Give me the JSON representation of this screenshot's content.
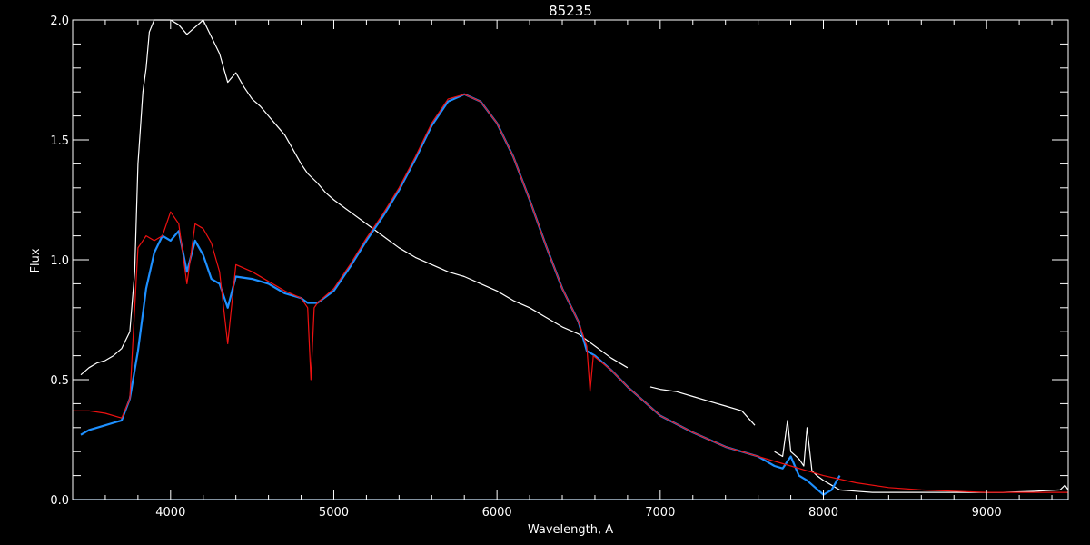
{
  "chart_data": {
    "type": "line",
    "title": "85235",
    "xlabel": "Wavelength, A",
    "ylabel": "Flux",
    "xlim": [
      3400,
      9500
    ],
    "ylim": [
      0.0,
      2.0
    ],
    "x_ticks": [
      4000,
      5000,
      6000,
      7000,
      8000,
      9000
    ],
    "x_tick_labels": [
      "4000",
      "5000",
      "6000",
      "7000",
      "8000",
      "9000"
    ],
    "y_ticks": [
      0.0,
      0.5,
      1.0,
      1.5,
      2.0
    ],
    "y_tick_labels": [
      "0.0",
      "0.5",
      "1.0",
      "1.5",
      "2.0"
    ],
    "grid": false,
    "series": [
      {
        "color": "#ffffff",
        "points": [
          [
            3450,
            0.52
          ],
          [
            3500,
            0.55
          ],
          [
            3550,
            0.57
          ],
          [
            3600,
            0.58
          ],
          [
            3650,
            0.6
          ],
          [
            3700,
            0.63
          ],
          [
            3750,
            0.7
          ],
          [
            3780,
            0.95
          ],
          [
            3800,
            1.4
          ],
          [
            3830,
            1.7
          ],
          [
            3850,
            1.8
          ],
          [
            3870,
            1.95
          ],
          [
            3900,
            2.0
          ],
          [
            3950,
            2.0
          ],
          [
            4000,
            2.0
          ],
          [
            4050,
            1.98
          ],
          [
            4100,
            1.94
          ],
          [
            4150,
            1.97
          ],
          [
            4200,
            2.0
          ],
          [
            4250,
            1.93
          ],
          [
            4300,
            1.86
          ],
          [
            4350,
            1.74
          ],
          [
            4400,
            1.78
          ],
          [
            4450,
            1.72
          ],
          [
            4500,
            1.67
          ],
          [
            4550,
            1.64
          ],
          [
            4600,
            1.6
          ],
          [
            4650,
            1.56
          ],
          [
            4700,
            1.52
          ],
          [
            4750,
            1.46
          ],
          [
            4800,
            1.4
          ],
          [
            4840,
            1.36
          ],
          [
            4900,
            1.32
          ],
          [
            4950,
            1.28
          ],
          [
            5000,
            1.25
          ],
          [
            5100,
            1.2
          ],
          [
            5200,
            1.15
          ],
          [
            5300,
            1.1
          ],
          [
            5400,
            1.05
          ],
          [
            5500,
            1.01
          ],
          [
            5600,
            0.98
          ],
          [
            5700,
            0.95
          ],
          [
            5800,
            0.93
          ],
          [
            5900,
            0.9
          ],
          [
            6000,
            0.87
          ],
          [
            6100,
            0.83
          ],
          [
            6200,
            0.8
          ],
          [
            6300,
            0.76
          ],
          [
            6400,
            0.72
          ],
          [
            6500,
            0.69
          ],
          [
            6600,
            0.64
          ],
          [
            6700,
            0.59
          ],
          [
            6800,
            0.55
          ],
          null,
          [
            6940,
            0.47
          ],
          [
            7000,
            0.46
          ],
          [
            7100,
            0.45
          ],
          [
            7200,
            0.43
          ],
          [
            7300,
            0.41
          ],
          [
            7400,
            0.39
          ],
          [
            7500,
            0.37
          ],
          [
            7580,
            0.31
          ],
          null,
          [
            7700,
            0.2
          ],
          [
            7750,
            0.18
          ],
          [
            7780,
            0.33
          ],
          [
            7800,
            0.2
          ],
          [
            7850,
            0.17
          ],
          [
            7880,
            0.14
          ],
          [
            7900,
            0.3
          ],
          [
            7930,
            0.12
          ],
          [
            7960,
            0.1
          ],
          [
            8000,
            0.08
          ],
          [
            8050,
            0.06
          ],
          [
            8100,
            0.04
          ],
          [
            8200,
            0.035
          ],
          [
            8300,
            0.03
          ],
          [
            8500,
            0.03
          ],
          [
            8700,
            0.03
          ],
          [
            8900,
            0.03
          ],
          [
            9100,
            0.03
          ],
          [
            9300,
            0.035
          ],
          [
            9450,
            0.04
          ],
          [
            9480,
            0.06
          ],
          [
            9500,
            0.04
          ]
        ]
      },
      {
        "color": "#1e90ff",
        "points": [
          [
            3450,
            0.27
          ],
          [
            3500,
            0.29
          ],
          [
            3550,
            0.3
          ],
          [
            3600,
            0.31
          ],
          [
            3650,
            0.32
          ],
          [
            3700,
            0.33
          ],
          [
            3750,
            0.42
          ],
          [
            3800,
            0.62
          ],
          [
            3850,
            0.88
          ],
          [
            3900,
            1.03
          ],
          [
            3950,
            1.1
          ],
          [
            4000,
            1.08
          ],
          [
            4050,
            1.12
          ],
          [
            4100,
            0.95
          ],
          [
            4150,
            1.08
          ],
          [
            4200,
            1.02
          ],
          [
            4250,
            0.92
          ],
          [
            4300,
            0.9
          ],
          [
            4350,
            0.8
          ],
          [
            4400,
            0.93
          ],
          [
            4500,
            0.92
          ],
          [
            4600,
            0.9
          ],
          [
            4700,
            0.86
          ],
          [
            4800,
            0.84
          ],
          [
            4840,
            0.82
          ],
          [
            4900,
            0.82
          ],
          [
            5000,
            0.87
          ],
          [
            5100,
            0.97
          ],
          [
            5200,
            1.08
          ],
          [
            5300,
            1.18
          ],
          [
            5400,
            1.29
          ],
          [
            5500,
            1.42
          ],
          [
            5600,
            1.56
          ],
          [
            5700,
            1.66
          ],
          [
            5800,
            1.69
          ],
          [
            5900,
            1.66
          ],
          [
            6000,
            1.57
          ],
          [
            6100,
            1.43
          ],
          [
            6200,
            1.25
          ],
          [
            6300,
            1.06
          ],
          [
            6400,
            0.88
          ],
          [
            6500,
            0.74
          ],
          [
            6550,
            0.62
          ],
          [
            6600,
            0.6
          ],
          [
            6700,
            0.54
          ],
          [
            6800,
            0.47
          ],
          [
            6900,
            0.41
          ],
          [
            7000,
            0.35
          ],
          [
            7200,
            0.28
          ],
          [
            7400,
            0.22
          ],
          [
            7600,
            0.18
          ],
          [
            7700,
            0.14
          ],
          [
            7750,
            0.13
          ],
          [
            7800,
            0.18
          ],
          [
            7850,
            0.1
          ],
          [
            7900,
            0.08
          ],
          [
            7950,
            0.05
          ],
          [
            8000,
            0.02
          ],
          [
            8050,
            0.04
          ],
          [
            8100,
            0.1
          ]
        ]
      },
      {
        "color": "#ee1111",
        "points": [
          [
            3400,
            0.37
          ],
          [
            3500,
            0.37
          ],
          [
            3600,
            0.36
          ],
          [
            3700,
            0.34
          ],
          [
            3750,
            0.42
          ],
          [
            3800,
            1.05
          ],
          [
            3850,
            1.1
          ],
          [
            3900,
            1.08
          ],
          [
            3950,
            1.1
          ],
          [
            4000,
            1.2
          ],
          [
            4050,
            1.15
          ],
          [
            4100,
            0.9
          ],
          [
            4150,
            1.15
          ],
          [
            4200,
            1.13
          ],
          [
            4250,
            1.07
          ],
          [
            4300,
            0.95
          ],
          [
            4350,
            0.65
          ],
          [
            4400,
            0.98
          ],
          [
            4500,
            0.95
          ],
          [
            4600,
            0.91
          ],
          [
            4700,
            0.87
          ],
          [
            4800,
            0.84
          ],
          [
            4840,
            0.8
          ],
          [
            4860,
            0.5
          ],
          [
            4880,
            0.8
          ],
          [
            4900,
            0.82
          ],
          [
            5000,
            0.88
          ],
          [
            5100,
            0.98
          ],
          [
            5200,
            1.09
          ],
          [
            5300,
            1.19
          ],
          [
            5400,
            1.3
          ],
          [
            5500,
            1.43
          ],
          [
            5600,
            1.57
          ],
          [
            5700,
            1.67
          ],
          [
            5800,
            1.69
          ],
          [
            5900,
            1.66
          ],
          [
            6000,
            1.57
          ],
          [
            6100,
            1.43
          ],
          [
            6200,
            1.25
          ],
          [
            6300,
            1.06
          ],
          [
            6400,
            0.88
          ],
          [
            6500,
            0.74
          ],
          [
            6550,
            0.64
          ],
          [
            6570,
            0.45
          ],
          [
            6590,
            0.6
          ],
          [
            6700,
            0.54
          ],
          [
            6800,
            0.47
          ],
          [
            6900,
            0.41
          ],
          [
            7000,
            0.35
          ],
          [
            7200,
            0.28
          ],
          [
            7400,
            0.22
          ],
          [
            7600,
            0.18
          ],
          [
            7800,
            0.14
          ],
          [
            8000,
            0.1
          ],
          [
            8200,
            0.07
          ],
          [
            8400,
            0.05
          ],
          [
            8600,
            0.04
          ],
          [
            8800,
            0.035
          ],
          [
            9000,
            0.03
          ],
          [
            9200,
            0.03
          ],
          [
            9400,
            0.03
          ],
          [
            9500,
            0.03
          ]
        ]
      },
      {
        "color": "#1e90ff",
        "points": [
          [
            3400,
            0.0
          ],
          [
            9500,
            0.0
          ]
        ]
      }
    ]
  }
}
